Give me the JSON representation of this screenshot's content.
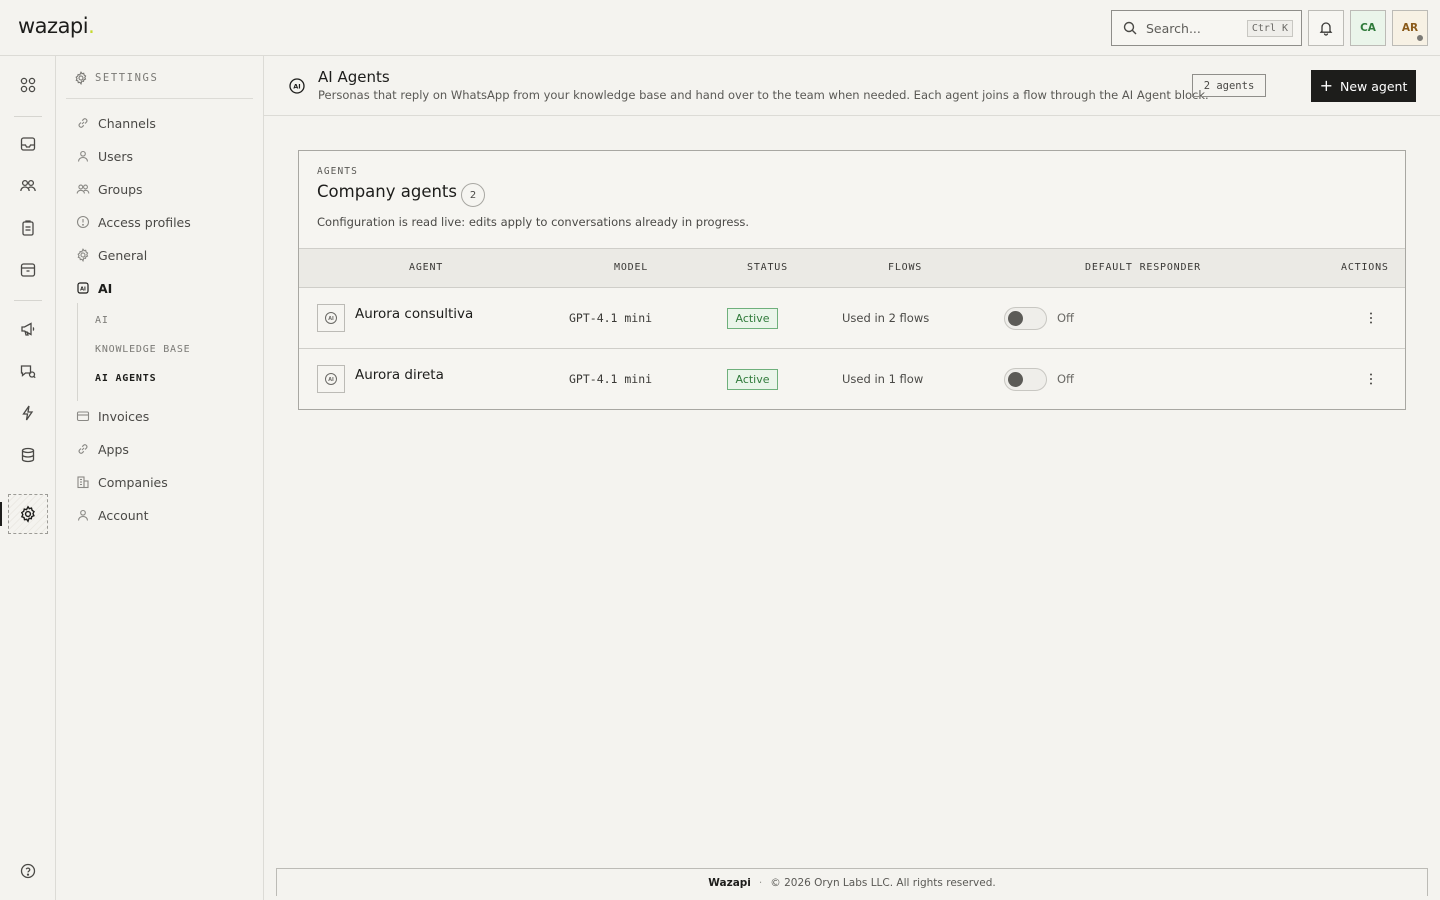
{
  "app": {
    "logo_text": "wazapi",
    "logo_dot": "."
  },
  "topbar": {
    "search_placeholder": "Search...",
    "search_shortcut": "Ctrl K",
    "company_initials": "CA",
    "user_initials": "AR"
  },
  "rail": {
    "icons": [
      "grid-icon",
      "inbox-icon",
      "contacts-icon",
      "clipboard-icon",
      "archive-icon",
      "megaphone-icon",
      "broadcast-icon",
      "bolt-icon",
      "database-icon",
      "settings-icon",
      "help-icon"
    ],
    "active": "settings-icon"
  },
  "sidebar": {
    "header": "SETTINGS",
    "items": [
      {
        "label": "Channels",
        "icon": "link-icon"
      },
      {
        "label": "Users",
        "icon": "user-icon"
      },
      {
        "label": "Groups",
        "icon": "users-icon"
      },
      {
        "label": "Access profiles",
        "icon": "shield-icon"
      },
      {
        "label": "General",
        "icon": "gear-icon"
      },
      {
        "label": "AI",
        "icon": "ai-icon"
      },
      {
        "label": "Invoices",
        "icon": "invoice-icon"
      },
      {
        "label": "Apps",
        "icon": "link-icon"
      },
      {
        "label": "Companies",
        "icon": "building-icon"
      },
      {
        "label": "Account",
        "icon": "user-icon"
      }
    ],
    "ai_subitems": [
      "AI",
      "KNOWLEDGE BASE",
      "AI AGENTS"
    ],
    "active_subitem": "AI AGENTS"
  },
  "page": {
    "title": "AI Agents",
    "description": "Personas that reply on WhatsApp from your knowledge base and hand over to the team when needed. Each agent joins a flow through the AI Agent block.",
    "count_badge": "2 agents",
    "new_button": "New agent"
  },
  "card": {
    "kicker": "AGENTS",
    "title": "Company agents",
    "count": "2",
    "note": "Configuration is read live: edits apply to conversations already in progress.",
    "columns": [
      "AGENT",
      "MODEL",
      "STATUS",
      "FLOWS",
      "DEFAULT RESPONDER",
      "ACTIONS"
    ],
    "rows": [
      {
        "name": "Aurora consultiva",
        "model": "GPT-4.1 mini",
        "status": "Active",
        "flows": "Used in 2 flows",
        "default_responder": "Off"
      },
      {
        "name": "Aurora direta",
        "model": "GPT-4.1 mini",
        "status": "Active",
        "flows": "Used in 1 flow",
        "default_responder": "Off"
      }
    ]
  },
  "footer": {
    "brand": "Wazapi",
    "separator": "·",
    "copyright": "© 2026 Oryn Labs LLC. All rights reserved."
  },
  "colors": {
    "background": "#f4f3ef",
    "primary_button": "#1d1d1b",
    "status_active": "#2f7a3a",
    "logo_accent": "#c5d92d"
  }
}
